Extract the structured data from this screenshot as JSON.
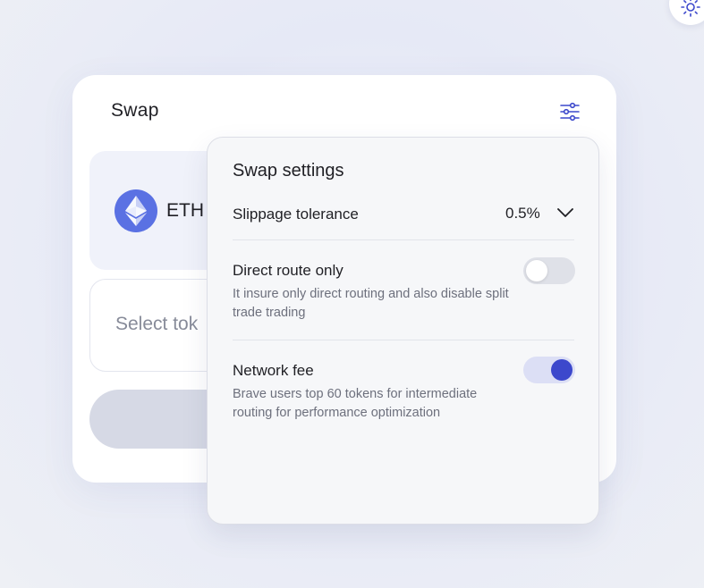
{
  "colors": {
    "accent": "#3c48cc",
    "eth_logo": "#5a71e3",
    "panel_bg": "#f0f2fa"
  },
  "icons": {
    "theme": "sun-icon",
    "settings": "sliders-icon",
    "token": "ethereum-icon",
    "dropdown": "chevron-down-icon"
  },
  "swap": {
    "title": "Swap",
    "from_token": "ETH",
    "to_placeholder": "Select tok"
  },
  "settings": {
    "title": "Swap settings",
    "slippage": {
      "label": "Slippage tolerance",
      "value": "0.5%"
    },
    "direct_route": {
      "label": "Direct route only",
      "description": "It insure only direct routing and also disable split trade trading",
      "enabled": false
    },
    "network_fee": {
      "label": "Network fee",
      "description": "Brave users top 60 tokens for intermediate routing for performance optimization",
      "enabled": true
    }
  }
}
